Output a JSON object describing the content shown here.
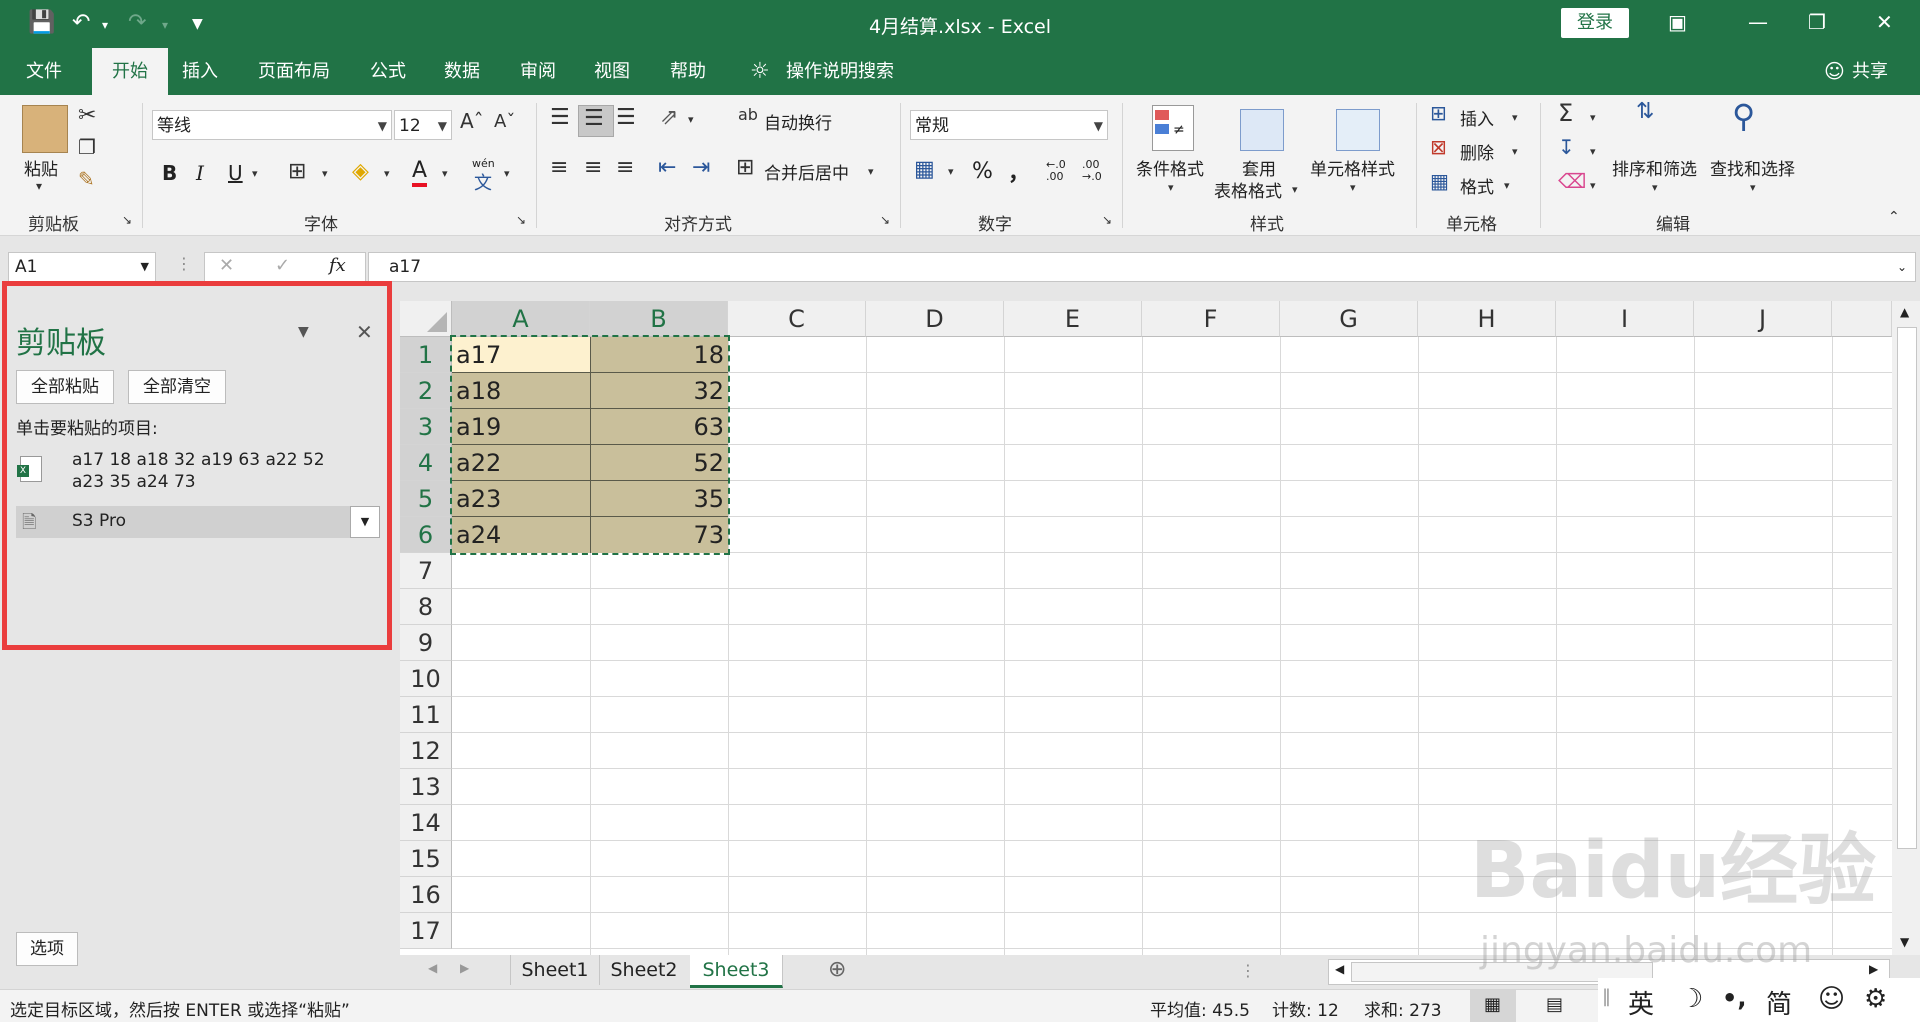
{
  "window": {
    "title": "4月结算.xlsx  -  Excel",
    "login_label": "登录"
  },
  "tabs": [
    "文件",
    "开始",
    "插入",
    "页面布局",
    "公式",
    "数据",
    "审阅",
    "视图",
    "帮助"
  ],
  "tell_me": "操作说明搜索",
  "share": "共享",
  "ribbon": {
    "paste_label": "粘贴",
    "groups": {
      "clipboard": "剪贴板",
      "font": "字体",
      "alignment": "对齐方式",
      "number": "数字",
      "styles": "样式",
      "cells": "单元格",
      "editing": "编辑"
    },
    "font_name": "等线",
    "font_size": "12",
    "wrap_text": "自动换行",
    "merge_center": "合并后居中",
    "number_format": "常规",
    "percent": "%",
    "comma": "，",
    "conditional_format": "条件格式",
    "format_as_table_1": "套用",
    "format_as_table_2": "表格格式",
    "cell_styles": "单元格样式",
    "insert": "插入",
    "delete": "删除",
    "format": "格式",
    "sort_filter": "排序和筛选",
    "find_select": "查找和选择",
    "bold": "B",
    "italic": "I",
    "underline": "U",
    "wen": "wén"
  },
  "formula_bar": {
    "name_box": "A1",
    "fx": "fx",
    "value": "a17"
  },
  "clipboard_pane": {
    "title": "剪贴板",
    "paste_all": "全部粘贴",
    "clear_all": "全部清空",
    "hint": "单击要粘贴的项目:",
    "items": [
      {
        "line1": "a17 18 a18 32 a19 63 a22 52",
        "line2": "a23 35 a24 73"
      },
      {
        "line1": "S3 Pro",
        "line2": ""
      }
    ],
    "options": "选项"
  },
  "sheet": {
    "columns": [
      "A",
      "B",
      "C",
      "D",
      "E",
      "F",
      "G",
      "H",
      "I",
      "J"
    ],
    "rows": [
      "1",
      "2",
      "3",
      "4",
      "5",
      "6",
      "7",
      "8",
      "9",
      "10",
      "11",
      "12",
      "13",
      "14",
      "15",
      "16",
      "17"
    ],
    "data": [
      [
        "a17",
        "18"
      ],
      [
        "a18",
        "32"
      ],
      [
        "a19",
        "63"
      ],
      [
        "a22",
        "52"
      ],
      [
        "a23",
        "35"
      ],
      [
        "a24",
        "73"
      ]
    ]
  },
  "sheet_tabs": [
    "Sheet1",
    "Sheet2",
    "Sheet3"
  ],
  "status": {
    "message": "选定目标区域，然后按 ENTER 或选择“粘贴”",
    "average": "平均值: 45.5",
    "count": "计数: 12",
    "sum": "求和: 273"
  },
  "ime": [
    "英",
    "简"
  ],
  "watermark": {
    "main": "Baidu经验",
    "sub": "jingyan.baidu.com"
  },
  "colors": {
    "excel_green": "#217346",
    "selection_fill": "#c9bf9b",
    "active_cell": "#fdf1cf",
    "highlight": "#ea3d3d"
  }
}
